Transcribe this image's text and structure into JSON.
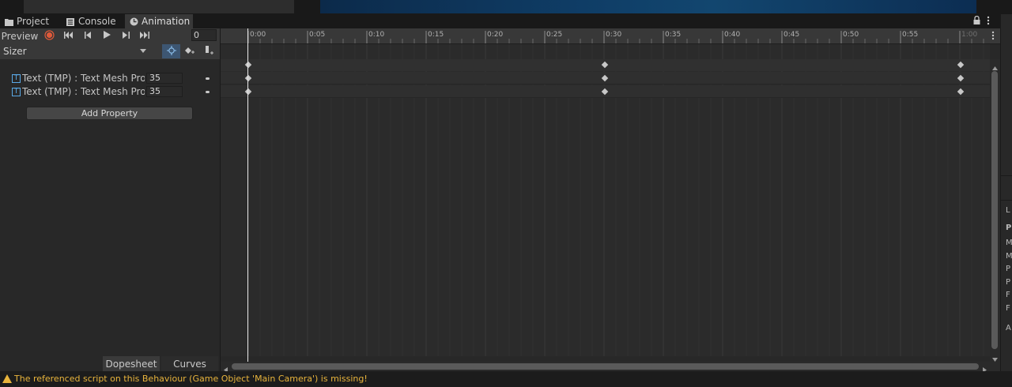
{
  "tabs": [
    {
      "label": "Project",
      "icon": "folder-icon"
    },
    {
      "label": "Console",
      "icon": "console-icon"
    },
    {
      "label": "Animation",
      "icon": "animation-icon",
      "active": true
    }
  ],
  "toolbar": {
    "preview_label": "Preview",
    "frame_value": "0"
  },
  "clip": {
    "name": "Sizer"
  },
  "properties": [
    {
      "label": "Text (TMP) : Text Mesh Pro UI.Font Size",
      "value": "35"
    },
    {
      "label": "Text (TMP) : Text Mesh Pro UI.Font Size",
      "value": "35"
    }
  ],
  "add_property_label": "Add Property",
  "ruler": {
    "labels": [
      "0:00",
      "0:05",
      "0:10",
      "0:15",
      "0:20",
      "0:25",
      "0:30",
      "0:35",
      "0:40",
      "0:45",
      "0:50",
      "0:55",
      "1:00"
    ]
  },
  "view_tabs": {
    "dopesheet": "Dopesheet",
    "curves": "Curves"
  },
  "right_panel_letters": [
    "L",
    "P",
    "M",
    "M",
    "P",
    "P",
    "F",
    "F",
    "A"
  ],
  "status": {
    "message": "The referenced script on this Behaviour (Game Object 'Main Camera') is missing!"
  },
  "colors": {
    "accent": "#3d5672",
    "record": "#e05a3a",
    "warning": "#e8b43c"
  }
}
